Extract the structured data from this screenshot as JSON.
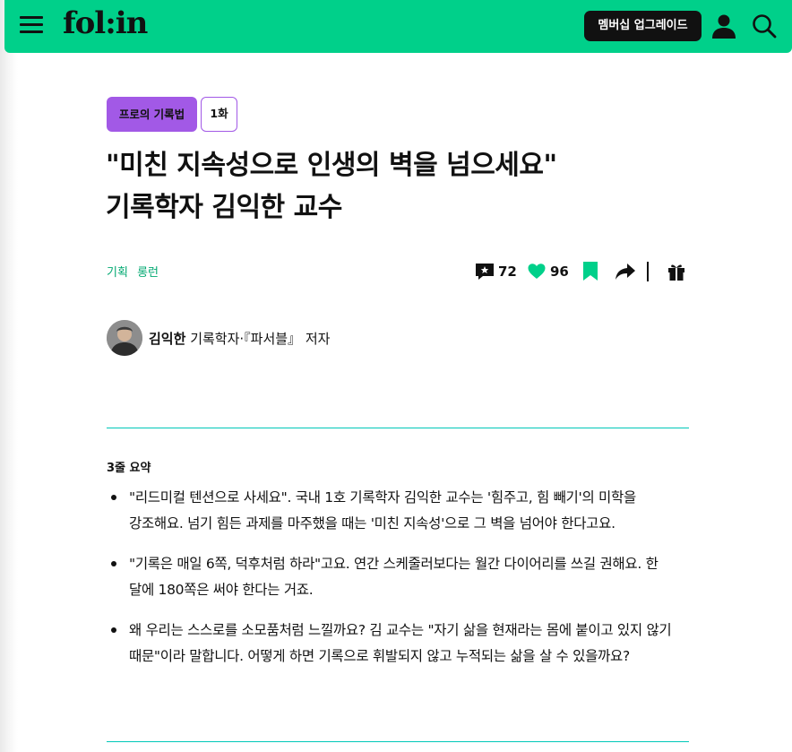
{
  "header": {
    "logo": "fol:in",
    "membership_button": "멤버십 업그레이드",
    "bg_color": "#00d08a"
  },
  "icons": {
    "menu": "hamburger-menu-icon",
    "profile": "user-icon",
    "search": "search-icon",
    "comment": "comment-icon",
    "like": "heart-icon",
    "bookmark": "bookmark-icon",
    "share": "share-icon",
    "gift": "gift-icon"
  },
  "article": {
    "series_tag": "프로의 기록법",
    "episode_tag": "1화",
    "title_line1": "\"미친 지속성으로 인생의 벽을 넘으세요\"",
    "title_line2": "기록학자 김익한 교수",
    "keywords": [
      "기획",
      "롱런"
    ],
    "comment_count": "72",
    "like_count": "96"
  },
  "author": {
    "name": "김익한",
    "description": "기록학자·『파서블』 저자"
  },
  "summary": {
    "title": "3줄 요약",
    "items": [
      "\"리드미컬 텐션으로 사세요\". 국내 1호 기록학자 김익한 교수는 '힘주고, 힘 빼기'의 미학을 강조해요. 넘기 힘든 과제를 마주했을 때는 '미친 지속성'으로 그 벽을 넘어야 한다고요.",
      "\"기록은 매일 6쪽, 덕후처럼 하라\"고요. 연간 스케줄러보다는 월간 다이어리를 쓰길 권해요. 한 달에 180쪽은 써야 한다는 거죠.",
      "왜 우리는 스스로를 소모품처럼 느낄까요? 김 교수는 \"자기 삶을 현재라는 몸에 붙이고 있지 않기 때문\"이라 말합니다. 어떻게 하면 기록으로 휘발되지 않고 누적되는 삶을 살 수 있을까요?"
    ]
  },
  "colors": {
    "accent_green": "#00d08a",
    "tag_purple": "#a259e6",
    "keyword_green": "#00a870",
    "divider_teal": "#00c8b8"
  }
}
